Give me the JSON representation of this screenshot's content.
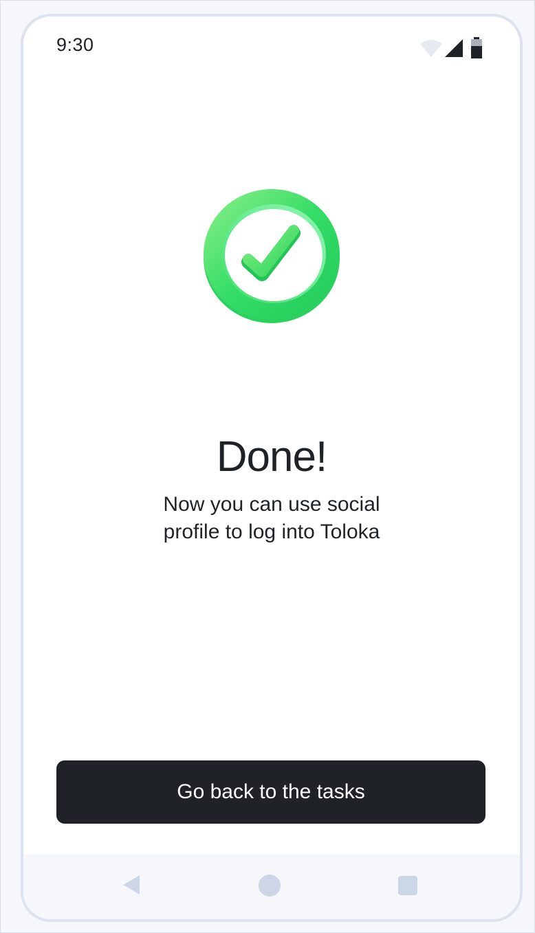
{
  "status_bar": {
    "time": "9:30",
    "icons": [
      "wifi-icon",
      "cellular-signal-icon",
      "battery-icon"
    ]
  },
  "graphic": {
    "icon": "success-check-icon",
    "color": "#33dd66"
  },
  "content": {
    "title": "Done!",
    "message": "Now you can use social profile to log into Toloka"
  },
  "actions": {
    "primary_label": "Go back to the tasks"
  },
  "navigation": {
    "icons": [
      "back-icon",
      "home-icon",
      "recent-apps-icon"
    ]
  },
  "colors": {
    "primary_button": "#1f2226",
    "nav_icons": "#cdd6e6",
    "success": "#33dd66"
  }
}
